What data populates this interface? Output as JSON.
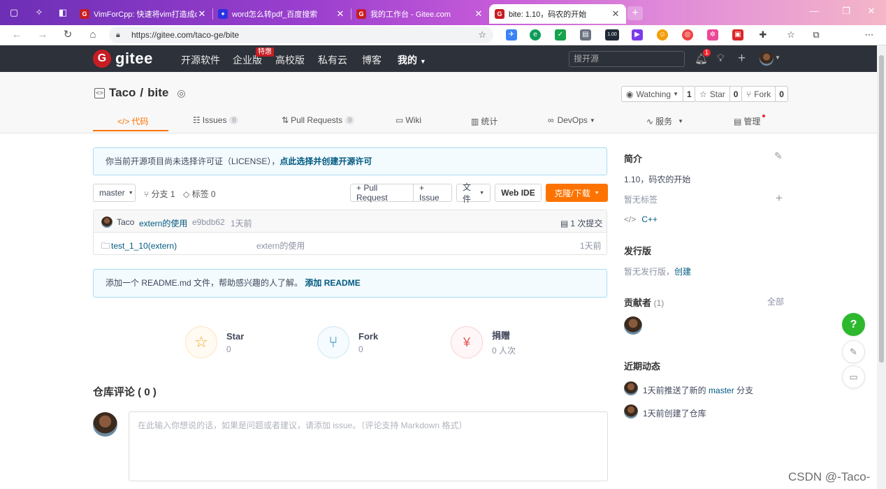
{
  "browser": {
    "tabs": [
      {
        "title": "VimForCpp: 快速将vim打造成c++",
        "icon_color": "#c71d23"
      },
      {
        "title": "word怎么转pdf_百度搜索",
        "icon_color": "#2932e1"
      },
      {
        "title": "我的工作台 - Gitee.com",
        "icon_color": "#c71d23"
      },
      {
        "title": "bite: 1.10，码农的开始",
        "icon_color": "#c71d23"
      }
    ],
    "url": "https://gitee.com/taco-ge/bite",
    "ext_badge": "1.00"
  },
  "header": {
    "logo_mark": "G",
    "logo_text": "gitee",
    "nav": [
      "开源软件",
      "企业版",
      "高校版",
      "私有云",
      "博客",
      "我的"
    ],
    "hot_badge": "特惠",
    "search_placeholder": "搜开源",
    "notification_count": "1"
  },
  "repo": {
    "owner": "Taco",
    "sep": "/",
    "name": "bite",
    "watch_label": "Watching",
    "watch_count": "1",
    "star_label": "Star",
    "star_count": "0",
    "fork_label": "Fork",
    "fork_count": "0",
    "tabs": [
      {
        "label": "代码"
      },
      {
        "label": "Issues",
        "count": "0"
      },
      {
        "label": "Pull Requests",
        "count": "0"
      },
      {
        "label": "Wiki"
      },
      {
        "label": "统计"
      },
      {
        "label": "DevOps"
      },
      {
        "label": "服务"
      },
      {
        "label": "管理"
      }
    ]
  },
  "license_notice": {
    "text": "你当前开源项目尚未选择许可证（LICENSE），",
    "link": "点此选择并创建开源许可"
  },
  "branch_bar": {
    "branch": "master",
    "branches": "分支 1",
    "tags": "标签 0",
    "pull_request": "+ Pull Request",
    "issue": "+ Issue",
    "files": "文件",
    "web_ide": "Web IDE",
    "clone": "克隆/下载"
  },
  "commit": {
    "author": "Taco",
    "message": "extern的使用",
    "hash": "e9bdb62",
    "time": "1天前",
    "count": "1 次提交"
  },
  "files": [
    {
      "name": "test_1_10(extern)",
      "message": "extern的使用",
      "time": "1天前"
    }
  ],
  "readme_notice": {
    "text": "添加一个 README.md 文件，帮助感兴趣的人了解。",
    "link": "添加 README"
  },
  "actions": [
    {
      "name": "Star",
      "value": "0"
    },
    {
      "name": "Fork",
      "value": "0"
    },
    {
      "name": "捐赠",
      "value": "0 人次"
    }
  ],
  "comments": {
    "title": "仓库评论 ( 0 )",
    "placeholder": "在此输入你想说的话，如果是问题或者建议，请添加 issue。（评论支持 Markdown 格式）"
  },
  "sidebar": {
    "intro_title": "简介",
    "intro_text": "1.10，码农的开始",
    "no_tags": "暂无标签",
    "language": "C++",
    "release_title": "发行版",
    "no_release": "暂无发行版，",
    "create": "创建",
    "contrib_title": "贡献者",
    "contrib_count": "(1)",
    "all": "全部",
    "activity_title": "近期动态",
    "activities": [
      "1天前推送了新的",
      "master",
      "分支",
      "1天前创建了仓库"
    ]
  },
  "watermark": "CSDN @-Taco-"
}
